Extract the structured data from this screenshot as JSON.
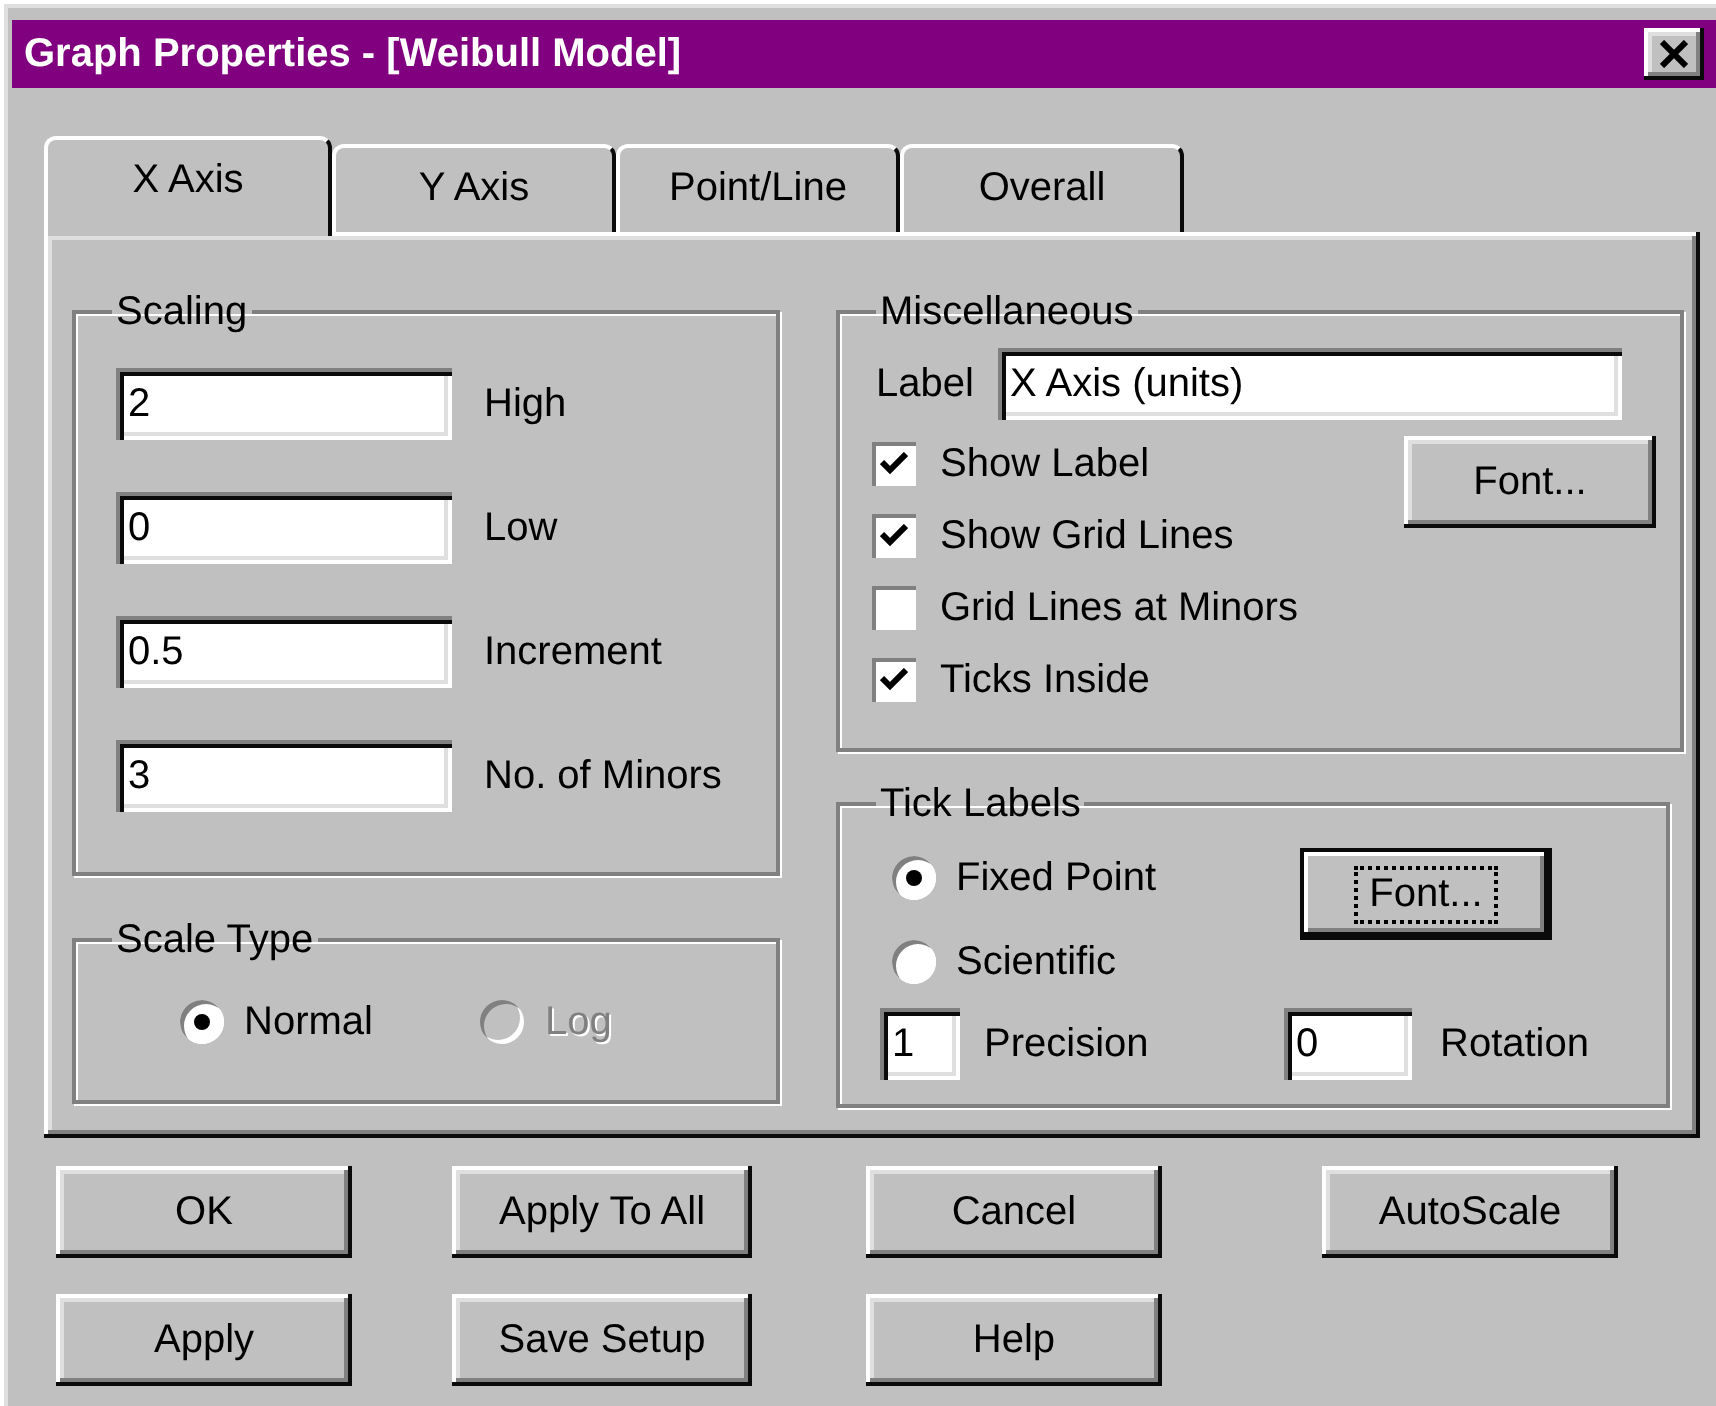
{
  "window": {
    "title": "Graph Properties - [Weibull Model]"
  },
  "tabs": [
    {
      "label": "X Axis",
      "selected": true
    },
    {
      "label": "Y Axis",
      "selected": false
    },
    {
      "label": "Point/Line",
      "selected": false
    },
    {
      "label": "Overall",
      "selected": false
    }
  ],
  "scaling": {
    "title": "Scaling",
    "fields": [
      {
        "value": "2",
        "label": "High"
      },
      {
        "value": "0",
        "label": "Low"
      },
      {
        "value": "0.5",
        "label": "Increment"
      },
      {
        "value": "3",
        "label": "No. of Minors"
      }
    ]
  },
  "scale_type": {
    "title": "Scale Type",
    "options": [
      {
        "label": "Normal",
        "selected": true,
        "disabled": false
      },
      {
        "label": "Log",
        "selected": false,
        "disabled": true
      }
    ]
  },
  "miscellaneous": {
    "title": "Miscellaneous",
    "label_field": {
      "label": "Label",
      "value": "X Axis (units)"
    },
    "checkboxes": [
      {
        "label": "Show Label",
        "checked": true
      },
      {
        "label": "Show Grid Lines",
        "checked": true
      },
      {
        "label": "Grid Lines at Minors",
        "checked": false
      },
      {
        "label": "Ticks Inside",
        "checked": true
      }
    ],
    "font_button": {
      "label": "Font...",
      "focused": false
    }
  },
  "tick_labels": {
    "title": "Tick Labels",
    "options": [
      {
        "label": "Fixed Point",
        "selected": true,
        "disabled": false
      },
      {
        "label": "Scientific",
        "selected": false,
        "disabled": false
      }
    ],
    "font_button": {
      "label": "Font...",
      "focused": true
    },
    "precision": {
      "value": "1",
      "label": "Precision"
    },
    "rotation": {
      "value": "0",
      "label": "Rotation"
    }
  },
  "button_rows": [
    [
      {
        "label": "OK"
      },
      {
        "label": "Apply To All"
      },
      {
        "label": "Cancel"
      },
      {
        "label": "AutoScale"
      }
    ],
    [
      {
        "label": "Apply"
      },
      {
        "label": "Save Setup"
      },
      {
        "label": "Help"
      }
    ]
  ]
}
